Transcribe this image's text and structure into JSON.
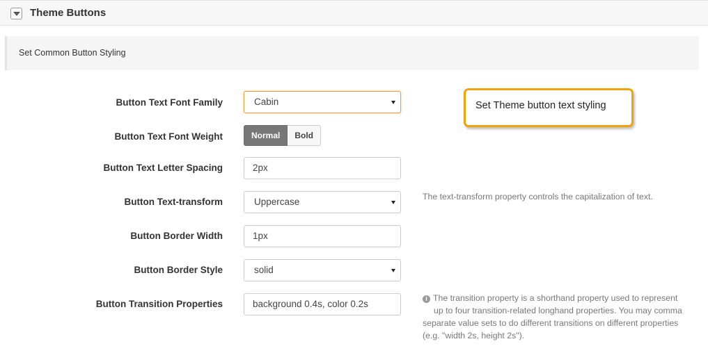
{
  "panel": {
    "title": "Theme Buttons",
    "toggle_icon": "collapse-triangle-icon"
  },
  "section": {
    "label": "Set Common Button Styling"
  },
  "fields": {
    "font_family": {
      "label": "Button Text Font Family",
      "value": "Cabin"
    },
    "font_weight": {
      "label": "Button Text Font Weight",
      "options": [
        "Normal",
        "Bold"
      ],
      "selected": "Normal"
    },
    "letter_spacing": {
      "label": "Button Text Letter Spacing",
      "value": "2px"
    },
    "text_transform": {
      "label": "Button Text-transform",
      "value": "Uppercase",
      "description": "The text-transform property controls the capitalization of text."
    },
    "border_width": {
      "label": "Button Border Width",
      "value": "1px"
    },
    "border_style": {
      "label": "Button Border Style",
      "value": "solid"
    },
    "transition": {
      "label": "Button Transition Properties",
      "value": "background 0.4s, color 0.2s",
      "description_lines": [
        "The transition property is a shorthand property used to represent",
        "up to four transition-related longhand properties. You may comma",
        "separate value sets to do different transitions on different properties",
        "(e.g. \"width 2s, height 2s\")."
      ]
    }
  },
  "tooltip": {
    "text": "Set Theme button text styling"
  },
  "colors": {
    "accent": "#f0a40a",
    "active_button": "#777777",
    "focus_border": "#e5a03a"
  }
}
